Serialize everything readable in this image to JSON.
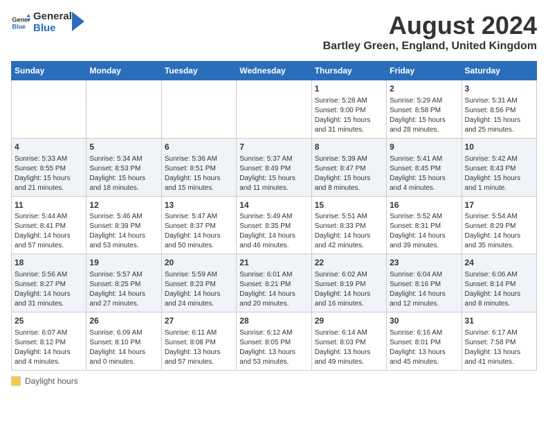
{
  "header": {
    "logo_general": "General",
    "logo_blue": "Blue",
    "main_title": "August 2024",
    "subtitle": "Bartley Green, England, United Kingdom"
  },
  "days_of_week": [
    "Sunday",
    "Monday",
    "Tuesday",
    "Wednesday",
    "Thursday",
    "Friday",
    "Saturday"
  ],
  "footer": {
    "daylight_label": "Daylight hours"
  },
  "weeks": [
    [
      {
        "day": "",
        "content": ""
      },
      {
        "day": "",
        "content": ""
      },
      {
        "day": "",
        "content": ""
      },
      {
        "day": "",
        "content": ""
      },
      {
        "day": "1",
        "content": "Sunrise: 5:28 AM\nSunset: 9:00 PM\nDaylight: 15 hours\nand 31 minutes."
      },
      {
        "day": "2",
        "content": "Sunrise: 5:29 AM\nSunset: 8:58 PM\nDaylight: 15 hours\nand 28 minutes."
      },
      {
        "day": "3",
        "content": "Sunrise: 5:31 AM\nSunset: 8:56 PM\nDaylight: 15 hours\nand 25 minutes."
      }
    ],
    [
      {
        "day": "4",
        "content": "Sunrise: 5:33 AM\nSunset: 8:55 PM\nDaylight: 15 hours\nand 21 minutes."
      },
      {
        "day": "5",
        "content": "Sunrise: 5:34 AM\nSunset: 8:53 PM\nDaylight: 15 hours\nand 18 minutes."
      },
      {
        "day": "6",
        "content": "Sunrise: 5:36 AM\nSunset: 8:51 PM\nDaylight: 15 hours\nand 15 minutes."
      },
      {
        "day": "7",
        "content": "Sunrise: 5:37 AM\nSunset: 8:49 PM\nDaylight: 15 hours\nand 11 minutes."
      },
      {
        "day": "8",
        "content": "Sunrise: 5:39 AM\nSunset: 8:47 PM\nDaylight: 15 hours\nand 8 minutes."
      },
      {
        "day": "9",
        "content": "Sunrise: 5:41 AM\nSunset: 8:45 PM\nDaylight: 15 hours\nand 4 minutes."
      },
      {
        "day": "10",
        "content": "Sunrise: 5:42 AM\nSunset: 8:43 PM\nDaylight: 15 hours\nand 1 minute."
      }
    ],
    [
      {
        "day": "11",
        "content": "Sunrise: 5:44 AM\nSunset: 8:41 PM\nDaylight: 14 hours\nand 57 minutes."
      },
      {
        "day": "12",
        "content": "Sunrise: 5:46 AM\nSunset: 8:39 PM\nDaylight: 14 hours\nand 53 minutes."
      },
      {
        "day": "13",
        "content": "Sunrise: 5:47 AM\nSunset: 8:37 PM\nDaylight: 14 hours\nand 50 minutes."
      },
      {
        "day": "14",
        "content": "Sunrise: 5:49 AM\nSunset: 8:35 PM\nDaylight: 14 hours\nand 46 minutes."
      },
      {
        "day": "15",
        "content": "Sunrise: 5:51 AM\nSunset: 8:33 PM\nDaylight: 14 hours\nand 42 minutes."
      },
      {
        "day": "16",
        "content": "Sunrise: 5:52 AM\nSunset: 8:31 PM\nDaylight: 14 hours\nand 39 minutes."
      },
      {
        "day": "17",
        "content": "Sunrise: 5:54 AM\nSunset: 8:29 PM\nDaylight: 14 hours\nand 35 minutes."
      }
    ],
    [
      {
        "day": "18",
        "content": "Sunrise: 5:56 AM\nSunset: 8:27 PM\nDaylight: 14 hours\nand 31 minutes."
      },
      {
        "day": "19",
        "content": "Sunrise: 5:57 AM\nSunset: 8:25 PM\nDaylight: 14 hours\nand 27 minutes."
      },
      {
        "day": "20",
        "content": "Sunrise: 5:59 AM\nSunset: 8:23 PM\nDaylight: 14 hours\nand 24 minutes."
      },
      {
        "day": "21",
        "content": "Sunrise: 6:01 AM\nSunset: 8:21 PM\nDaylight: 14 hours\nand 20 minutes."
      },
      {
        "day": "22",
        "content": "Sunrise: 6:02 AM\nSunset: 8:19 PM\nDaylight: 14 hours\nand 16 minutes."
      },
      {
        "day": "23",
        "content": "Sunrise: 6:04 AM\nSunset: 8:16 PM\nDaylight: 14 hours\nand 12 minutes."
      },
      {
        "day": "24",
        "content": "Sunrise: 6:06 AM\nSunset: 8:14 PM\nDaylight: 14 hours\nand 8 minutes."
      }
    ],
    [
      {
        "day": "25",
        "content": "Sunrise: 6:07 AM\nSunset: 8:12 PM\nDaylight: 14 hours\nand 4 minutes."
      },
      {
        "day": "26",
        "content": "Sunrise: 6:09 AM\nSunset: 8:10 PM\nDaylight: 14 hours\nand 0 minutes."
      },
      {
        "day": "27",
        "content": "Sunrise: 6:11 AM\nSunset: 8:08 PM\nDaylight: 13 hours\nand 57 minutes."
      },
      {
        "day": "28",
        "content": "Sunrise: 6:12 AM\nSunset: 8:05 PM\nDaylight: 13 hours\nand 53 minutes."
      },
      {
        "day": "29",
        "content": "Sunrise: 6:14 AM\nSunset: 8:03 PM\nDaylight: 13 hours\nand 49 minutes."
      },
      {
        "day": "30",
        "content": "Sunrise: 6:16 AM\nSunset: 8:01 PM\nDaylight: 13 hours\nand 45 minutes."
      },
      {
        "day": "31",
        "content": "Sunrise: 6:17 AM\nSunset: 7:58 PM\nDaylight: 13 hours\nand 41 minutes."
      }
    ]
  ]
}
